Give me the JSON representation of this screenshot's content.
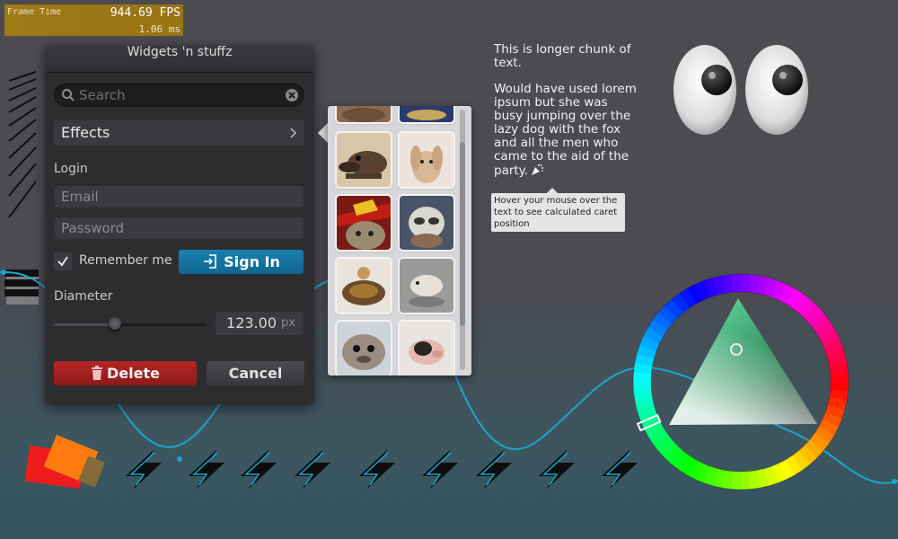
{
  "perf": {
    "label": "Frame Time",
    "fps": "944.69 FPS",
    "ms": "1.06 ms"
  },
  "window": {
    "title": "Widgets 'n stuffz",
    "search": {
      "placeholder": "Search",
      "value": ""
    },
    "effects": {
      "label": "Effects"
    },
    "login": {
      "label": "Login",
      "email_placeholder": "Email",
      "password_placeholder": "Password"
    },
    "remember": {
      "label": "Remember me",
      "checked": true
    },
    "signin": {
      "label": "Sign In"
    },
    "diameter": {
      "label": "Diameter",
      "value": "123.00",
      "unit": "px",
      "slider_fraction": 0.4
    },
    "buttons": {
      "delete": "Delete",
      "cancel": "Cancel"
    }
  },
  "popup": {
    "thumbnails": [
      "animal-top-1",
      "animal-top-2",
      "shrew",
      "bunny",
      "cat-hat",
      "baby-sloth",
      "tortoise",
      "hamster",
      "seal",
      "pig"
    ]
  },
  "text": {
    "p1": "This is longer chunk of text.",
    "p2": "Would have used lorem ipsum but she was busy jumping over the lazy dog with the fox and all the men who came to the aid of the party.",
    "tooltip": "Hover your mouse over the text to see calculated caret position"
  },
  "colors": {
    "signin": "#1a7fb0",
    "delete": "#b52626",
    "accent_line": "#1aa6cc",
    "fps_bar": "#a07a16",
    "picked": "#54d697"
  }
}
